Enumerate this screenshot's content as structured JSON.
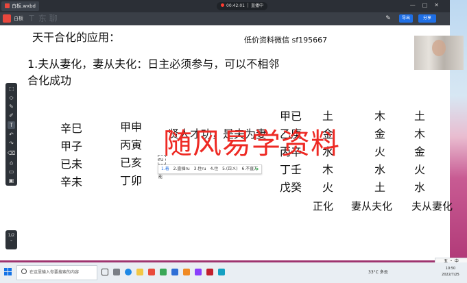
{
  "window": {
    "tab_title": "白板.wxbd",
    "app_name": "白板",
    "ghost_text": "Ｔ 东 聊",
    "record_time": "00:42:01",
    "record_label": "直播中",
    "export_label": "导出",
    "share_label": "分享"
  },
  "canvas": {
    "title": "天干合化的应用：",
    "contact": "低价资料微信  sf195667",
    "rule_line1": "1.夫从妻化，妻从夫化：日主必须参与，可以不相邻",
    "rule_line2": "合化成功",
    "col1": [
      "辛巳",
      "甲子",
      "已未",
      "辛未"
    ],
    "col2": [
      "甲申",
      "丙寅",
      "已亥",
      "丁卯"
    ],
    "hidden_text": "贤人才功，是夫为妻",
    "stems": [
      "甲已",
      "乙庚",
      "丙辛",
      "丁壬",
      "戊癸"
    ],
    "zhenghua": [
      "土",
      "金",
      "水",
      "木",
      "火"
    ],
    "qicongfu": [
      "木",
      "金",
      "火",
      "水",
      "土"
    ],
    "fucongqi": [
      "土",
      "木",
      "金",
      "火",
      "水"
    ],
    "footer_labels": [
      "正化",
      "妻从夫化",
      "夫从妻化"
    ],
    "watermark": "随风易学资料"
  },
  "ime": {
    "input": "ru",
    "candidates": [
      "1.着",
      "2.直插ru",
      "3.住ru",
      "4.住",
      "5.(ㄖㄨ)",
      "6.不直万能",
      "7.该ru"
    ]
  },
  "tools": [
    "select-icon",
    "shape-icon",
    "pen-icon",
    "marker-icon",
    "text-icon",
    "undo-icon",
    "redo-icon",
    "eraser-icon",
    "clip-icon",
    "lock-icon",
    "layers-icon"
  ],
  "page": {
    "label": "1/2"
  },
  "taskbar": {
    "search_placeholder": "在这里输入你要搜索的内容",
    "weather": "33°C 多云",
    "time": "10:50",
    "date": "2022/7/25",
    "ime_mode": "五 ・ 中"
  }
}
